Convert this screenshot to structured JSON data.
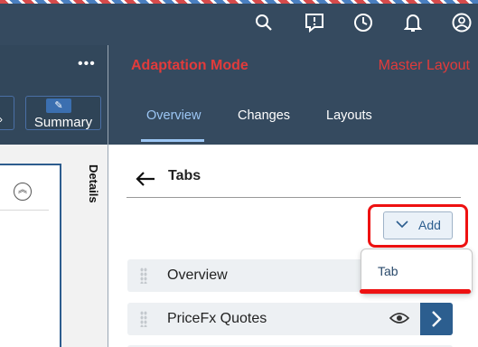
{
  "topbar": {
    "icons": [
      "search-icon",
      "feedback-icon",
      "clock-icon",
      "bell-icon",
      "user-icon"
    ]
  },
  "left_page": {
    "overflow_label": "•••",
    "summary_button": "Summary",
    "details_label": "Details"
  },
  "panel": {
    "mode_title": "Adaptation Mode",
    "layout_title": "Master Layout",
    "tabs": [
      {
        "label": "Overview",
        "active": true
      },
      {
        "label": "Changes",
        "active": false
      },
      {
        "label": "Layouts",
        "active": false
      }
    ],
    "section_title": "Tabs",
    "add_button": "Add",
    "add_menu": {
      "items": [
        "Tab"
      ]
    },
    "rows": [
      {
        "label": "Overview"
      },
      {
        "label": "PriceFx Quotes"
      }
    ]
  },
  "colors": {
    "shell": "#354a5f",
    "accent": "#9cc6f4",
    "annotation_red": "#ee1111",
    "mode_title_red": "#e23b3b"
  }
}
